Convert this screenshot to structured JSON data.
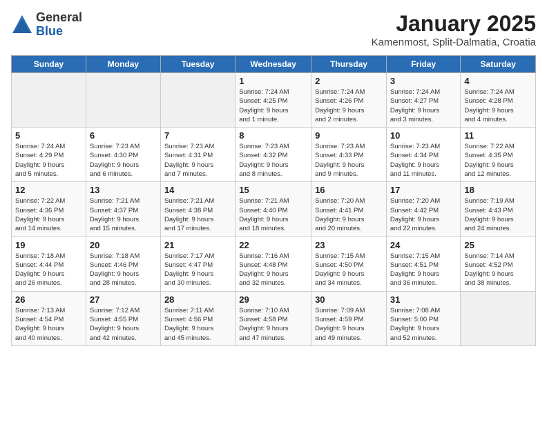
{
  "header": {
    "logo_general": "General",
    "logo_blue": "Blue",
    "month_title": "January 2025",
    "location": "Kamenmost, Split-Dalmatia, Croatia"
  },
  "weekdays": [
    "Sunday",
    "Monday",
    "Tuesday",
    "Wednesday",
    "Thursday",
    "Friday",
    "Saturday"
  ],
  "weeks": [
    [
      {
        "day": "",
        "detail": ""
      },
      {
        "day": "",
        "detail": ""
      },
      {
        "day": "",
        "detail": ""
      },
      {
        "day": "1",
        "detail": "Sunrise: 7:24 AM\nSunset: 4:25 PM\nDaylight: 9 hours\nand 1 minute."
      },
      {
        "day": "2",
        "detail": "Sunrise: 7:24 AM\nSunset: 4:26 PM\nDaylight: 9 hours\nand 2 minutes."
      },
      {
        "day": "3",
        "detail": "Sunrise: 7:24 AM\nSunset: 4:27 PM\nDaylight: 9 hours\nand 3 minutes."
      },
      {
        "day": "4",
        "detail": "Sunrise: 7:24 AM\nSunset: 4:28 PM\nDaylight: 9 hours\nand 4 minutes."
      }
    ],
    [
      {
        "day": "5",
        "detail": "Sunrise: 7:24 AM\nSunset: 4:29 PM\nDaylight: 9 hours\nand 5 minutes."
      },
      {
        "day": "6",
        "detail": "Sunrise: 7:23 AM\nSunset: 4:30 PM\nDaylight: 9 hours\nand 6 minutes."
      },
      {
        "day": "7",
        "detail": "Sunrise: 7:23 AM\nSunset: 4:31 PM\nDaylight: 9 hours\nand 7 minutes."
      },
      {
        "day": "8",
        "detail": "Sunrise: 7:23 AM\nSunset: 4:32 PM\nDaylight: 9 hours\nand 8 minutes."
      },
      {
        "day": "9",
        "detail": "Sunrise: 7:23 AM\nSunset: 4:33 PM\nDaylight: 9 hours\nand 9 minutes."
      },
      {
        "day": "10",
        "detail": "Sunrise: 7:23 AM\nSunset: 4:34 PM\nDaylight: 9 hours\nand 11 minutes."
      },
      {
        "day": "11",
        "detail": "Sunrise: 7:22 AM\nSunset: 4:35 PM\nDaylight: 9 hours\nand 12 minutes."
      }
    ],
    [
      {
        "day": "12",
        "detail": "Sunrise: 7:22 AM\nSunset: 4:36 PM\nDaylight: 9 hours\nand 14 minutes."
      },
      {
        "day": "13",
        "detail": "Sunrise: 7:21 AM\nSunset: 4:37 PM\nDaylight: 9 hours\nand 15 minutes."
      },
      {
        "day": "14",
        "detail": "Sunrise: 7:21 AM\nSunset: 4:38 PM\nDaylight: 9 hours\nand 17 minutes."
      },
      {
        "day": "15",
        "detail": "Sunrise: 7:21 AM\nSunset: 4:40 PM\nDaylight: 9 hours\nand 18 minutes."
      },
      {
        "day": "16",
        "detail": "Sunrise: 7:20 AM\nSunset: 4:41 PM\nDaylight: 9 hours\nand 20 minutes."
      },
      {
        "day": "17",
        "detail": "Sunrise: 7:20 AM\nSunset: 4:42 PM\nDaylight: 9 hours\nand 22 minutes."
      },
      {
        "day": "18",
        "detail": "Sunrise: 7:19 AM\nSunset: 4:43 PM\nDaylight: 9 hours\nand 24 minutes."
      }
    ],
    [
      {
        "day": "19",
        "detail": "Sunrise: 7:18 AM\nSunset: 4:44 PM\nDaylight: 9 hours\nand 26 minutes."
      },
      {
        "day": "20",
        "detail": "Sunrise: 7:18 AM\nSunset: 4:46 PM\nDaylight: 9 hours\nand 28 minutes."
      },
      {
        "day": "21",
        "detail": "Sunrise: 7:17 AM\nSunset: 4:47 PM\nDaylight: 9 hours\nand 30 minutes."
      },
      {
        "day": "22",
        "detail": "Sunrise: 7:16 AM\nSunset: 4:48 PM\nDaylight: 9 hours\nand 32 minutes."
      },
      {
        "day": "23",
        "detail": "Sunrise: 7:15 AM\nSunset: 4:50 PM\nDaylight: 9 hours\nand 34 minutes."
      },
      {
        "day": "24",
        "detail": "Sunrise: 7:15 AM\nSunset: 4:51 PM\nDaylight: 9 hours\nand 36 minutes."
      },
      {
        "day": "25",
        "detail": "Sunrise: 7:14 AM\nSunset: 4:52 PM\nDaylight: 9 hours\nand 38 minutes."
      }
    ],
    [
      {
        "day": "26",
        "detail": "Sunrise: 7:13 AM\nSunset: 4:54 PM\nDaylight: 9 hours\nand 40 minutes."
      },
      {
        "day": "27",
        "detail": "Sunrise: 7:12 AM\nSunset: 4:55 PM\nDaylight: 9 hours\nand 42 minutes."
      },
      {
        "day": "28",
        "detail": "Sunrise: 7:11 AM\nSunset: 4:56 PM\nDaylight: 9 hours\nand 45 minutes."
      },
      {
        "day": "29",
        "detail": "Sunrise: 7:10 AM\nSunset: 4:58 PM\nDaylight: 9 hours\nand 47 minutes."
      },
      {
        "day": "30",
        "detail": "Sunrise: 7:09 AM\nSunset: 4:59 PM\nDaylight: 9 hours\nand 49 minutes."
      },
      {
        "day": "31",
        "detail": "Sunrise: 7:08 AM\nSunset: 5:00 PM\nDaylight: 9 hours\nand 52 minutes."
      },
      {
        "day": "",
        "detail": ""
      }
    ]
  ]
}
